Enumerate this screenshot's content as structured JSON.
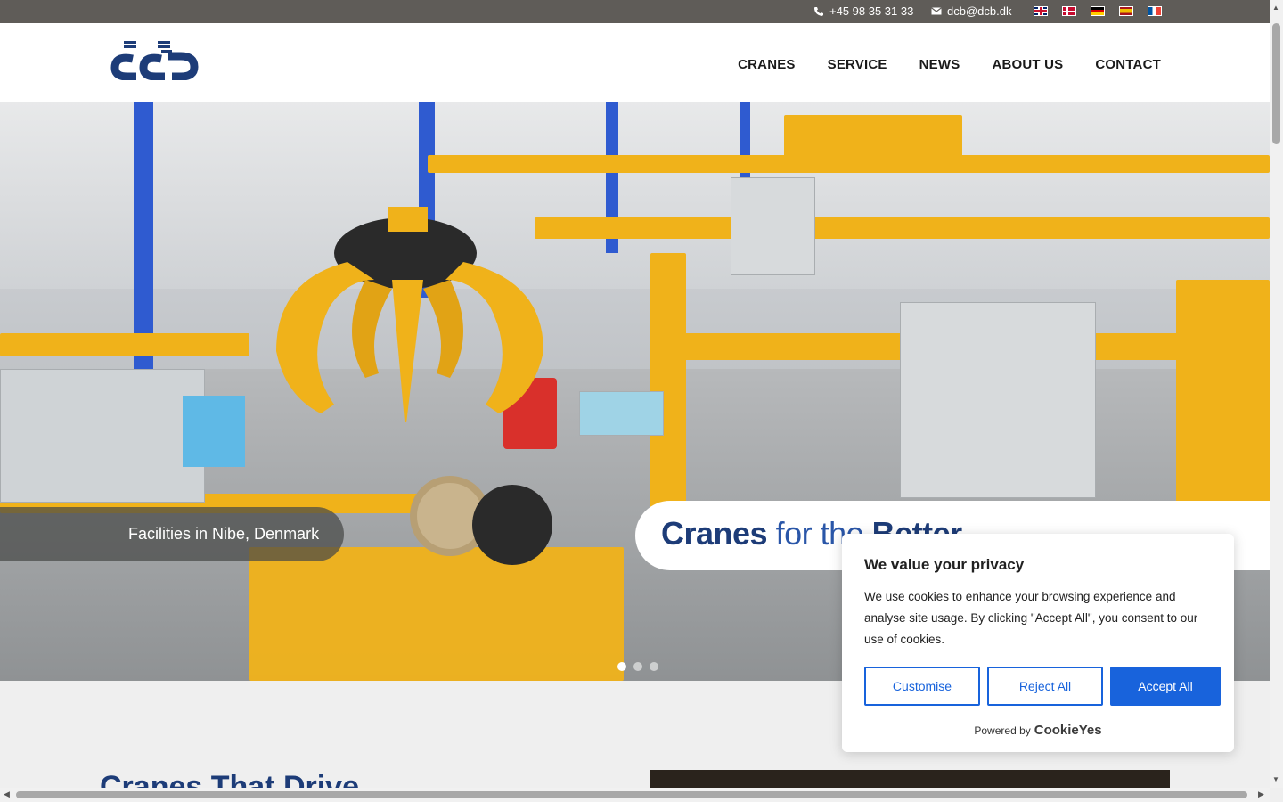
{
  "topbar": {
    "phone": "+45 98 35 31 33",
    "email": "dcb@dcb.dk",
    "languages": [
      "English",
      "Dansk",
      "Deutsch",
      "Español",
      "Français"
    ]
  },
  "header": {
    "logo_text": "dcb",
    "nav": [
      "CRANES",
      "SERVICE",
      "NEWS",
      "ABOUT US",
      "CONTACT"
    ]
  },
  "hero": {
    "caption_left": "Facilities in Nibe, Denmark",
    "caption_right_bold": "Cranes",
    "caption_right_normal": " for the ",
    "caption_right_tail": "Better",
    "slide_count": 3,
    "active_slide": 1
  },
  "lower": {
    "heading": "Cranes That Drive"
  },
  "cookie": {
    "title": "We value your privacy",
    "body": "We use cookies to enhance your browsing experience and analyse site usage. By clicking \"Accept All\", you consent to our use of cookies.",
    "customise": "Customise",
    "reject": "Reject All",
    "accept": "Accept All",
    "powered_by": "Powered by",
    "brand": "CookieYes"
  },
  "colors": {
    "brand_blue": "#1d3c78",
    "cookie_blue": "#1863dc",
    "topbar_bg": "#5f5c58",
    "crane_yellow": "#f0b21a"
  }
}
